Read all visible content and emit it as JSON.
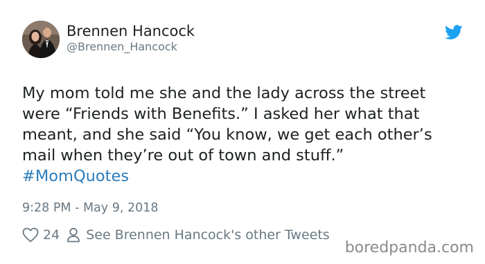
{
  "tweet": {
    "author": {
      "display_name": "Brennen Hancock",
      "handle": "@Brennen_Hancock",
      "avatar_icon": "profile-photo"
    },
    "brand_icon": "twitter-bird-icon",
    "brand_color": "#1da1f2",
    "text_lines": [
      "My mom told me she and the lady across the street",
      "were “Friends with Benefits.” I asked her what that",
      "meant, and she said “You know, we get each other’s",
      "mail when they’re out of town and stuff.”"
    ],
    "hashtag": "#MomQuotes",
    "hashtag_color": "#2b7bb9",
    "timestamp": "9:28 PM - May 9, 2018",
    "likes_count": "24",
    "other_tweets_link": "See Brennen Hancock's other Tweets"
  },
  "watermark": "boredpanda.com"
}
